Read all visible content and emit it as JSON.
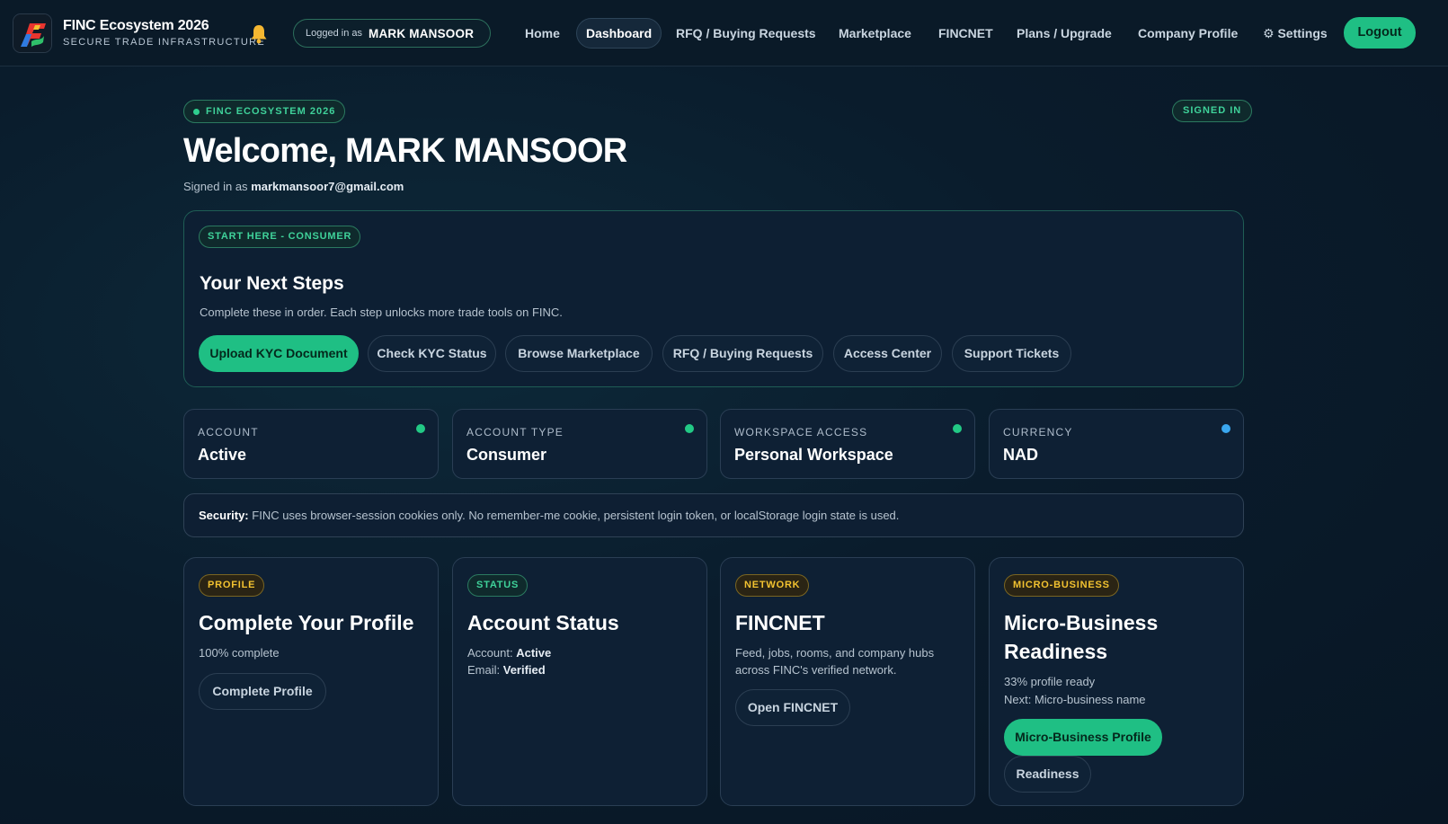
{
  "header": {
    "brand_title": "FINC Ecosystem 2026",
    "brand_subtitle": "SECURE TRADE INFRASTRUCTURE",
    "logged_in_label": "Logged in as",
    "logged_in_name": "MARK MANSOOR",
    "nav": {
      "home": "Home",
      "dashboard": "Dashboard",
      "rfq": "RFQ / Buying Requests",
      "marketplace": "Marketplace",
      "fincnet": "FINCNET",
      "plans": "Plans / Upgrade",
      "company_profile": "Company Profile",
      "settings": "⚙ Settings"
    },
    "active_nav": "Dashboard",
    "logout": "Logout",
    "icons": {
      "logo": "finc-logo-icon",
      "notifications": "bell-icon",
      "settings": "gear-icon"
    }
  },
  "hero": {
    "eyebrow": "FINC ECOSYSTEM 2026",
    "signed_badge": "SIGNED IN",
    "welcome": "Welcome, MARK MANSOOR",
    "signed_as_label": "Signed in as",
    "email": "markmansoor7@gmail.com"
  },
  "next_steps": {
    "chip": "START HERE - CONSUMER",
    "title": "Your Next Steps",
    "description": "Complete these in order. Each step unlocks more trade tools on FINC.",
    "buttons": {
      "upload_kyc": "Upload KYC Document",
      "check_kyc": "Check KYC Status",
      "browse_marketplace": "Browse Marketplace",
      "rfq": "RFQ / Buying Requests",
      "access_center": "Access Center",
      "support": "Support Tickets"
    }
  },
  "stats": {
    "account": {
      "label": "ACCOUNT",
      "value": "Active",
      "dot_color": "#22c985"
    },
    "account_type": {
      "label": "ACCOUNT TYPE",
      "value": "Consumer",
      "dot_color": "#22c985"
    },
    "workspace": {
      "label": "WORKSPACE ACCESS",
      "value": "Personal Workspace",
      "dot_color": "#22c985"
    },
    "currency": {
      "label": "CURRENCY",
      "value": "NAD",
      "dot_color": "#3aa7ef"
    }
  },
  "security": {
    "label": "Security:",
    "text": "FINC uses browser-session cookies only. No remember-me cookie, persistent login token, or localStorage login state is used."
  },
  "cards": {
    "profile": {
      "chip": "PROFILE",
      "title": "Complete Your Profile",
      "progress_text": "100% complete",
      "button": "Complete Profile"
    },
    "status": {
      "chip": "STATUS",
      "title": "Account Status",
      "account_label": "Account:",
      "account_value": "Active",
      "email_label": "Email:",
      "email_value": "Verified"
    },
    "network": {
      "chip": "NETWORK",
      "title": "FINCNET",
      "text": "Feed, jobs, rooms, and company hubs across FINC's verified network.",
      "button": "Open FINCNET"
    },
    "micro": {
      "chip": "MICRO-BUSINESS",
      "title": "Micro-Business Readiness",
      "progress_text": "33% profile ready",
      "next_text": "Next: Micro-business name",
      "button_primary": "Micro-Business Profile",
      "button_secondary": "Readiness"
    }
  },
  "colors": {
    "accent": "#1fbf84",
    "gold": "#f2c230",
    "background": "#0a1c2c"
  }
}
